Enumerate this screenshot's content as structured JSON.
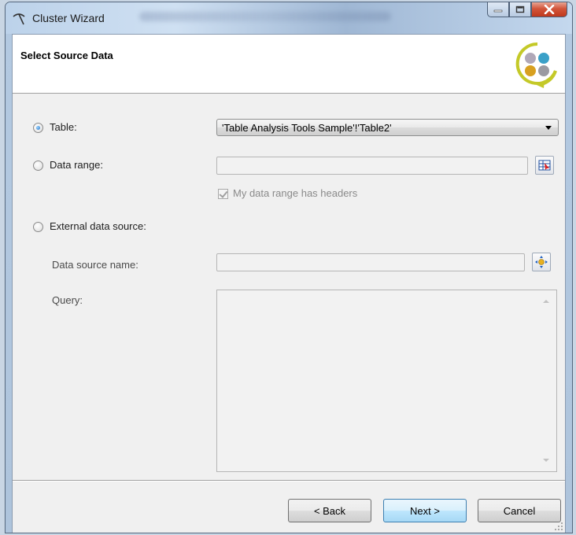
{
  "window": {
    "title": "Cluster Wizard"
  },
  "header": {
    "title": "Select Source Data"
  },
  "options": {
    "table": {
      "label": "Table:",
      "selected": true,
      "value": "'Table Analysis Tools Sample'!'Table2'"
    },
    "data_range": {
      "label": "Data range:",
      "selected": false,
      "value": "",
      "headers_checkbox_label": "My data range has headers",
      "headers_checked": true
    },
    "external": {
      "label": "External data source:",
      "selected": false,
      "data_source_name_label": "Data source name:",
      "data_source_name_value": "",
      "query_label": "Query:",
      "query_value": ""
    }
  },
  "footer": {
    "back_label": "< Back",
    "next_label": "Next >",
    "cancel_label": "Cancel"
  },
  "colors": {
    "radio_dot": "#1f6fc4",
    "default_button_border": "#3c7fb1"
  }
}
